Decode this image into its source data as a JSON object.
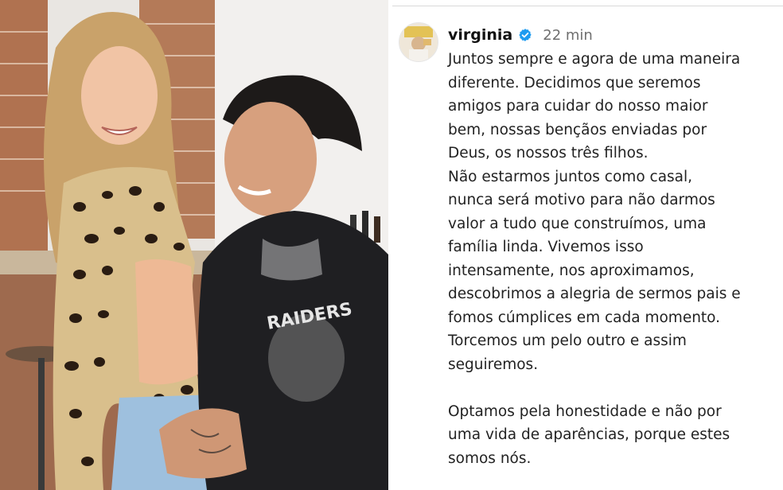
{
  "post": {
    "username": "virginia",
    "timestamp": "22 min",
    "verified": true,
    "caption_paragraph_1": [
      "Juntos sempre e agora de uma maneira",
      "diferente. Decidimos que seremos",
      "amigos para cuidar do nosso maior",
      "bem, nossas bençãos enviadas por",
      "Deus, os nossos três filhos.",
      "Não estarmos juntos como casal,",
      "nunca será motivo para não darmos",
      "valor a tudo que construímos, uma",
      "família linda. Vivemos isso",
      "intensamente, nos aproximamos,",
      "descobrimos a alegria de sermos pais e",
      "fomos cúmplices em cada momento.",
      "Torcemos um pelo outro e assim",
      "seguiremos."
    ],
    "caption_paragraph_2": [
      "Optamos pela honestidade e não por",
      "uma vida de aparências, porque estes",
      "somos nós."
    ]
  },
  "photo": {
    "jacket_text": "RAIDERS"
  },
  "colors": {
    "verified_badge": "#1d9bf0",
    "username": "#111111",
    "timestamp": "#6f6f6f",
    "caption": "#222222"
  }
}
